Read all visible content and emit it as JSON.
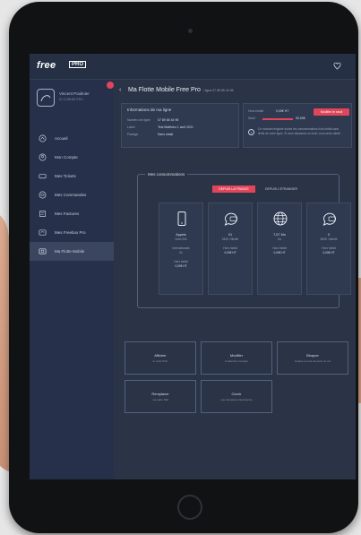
{
  "app": {
    "logo_text": "free",
    "logo_badge": "PRO"
  },
  "user": {
    "name": "Vincent Poulinier",
    "subtitle": "ID CONNECTED"
  },
  "sidebar": {
    "items": [
      {
        "label": "Accueil",
        "icon": "home-icon"
      },
      {
        "label": "Mon Compte",
        "icon": "user-icon"
      },
      {
        "label": "Mes Tickets",
        "icon": "ticket-icon"
      },
      {
        "label": "Mes Commandes",
        "icon": "cart-icon"
      },
      {
        "label": "Mes Factures",
        "icon": "invoice-icon"
      },
      {
        "label": "Mes Freebox Pro",
        "icon": "freebox-icon"
      },
      {
        "label": "Ma Flotte Mobile",
        "icon": "mobile-icon"
      }
    ],
    "active_index": 6
  },
  "header": {
    "title": "Ma Flotte Mobile Free Pro",
    "subtitle": "/ ligne 07 89 65 44 95"
  },
  "line_info": {
    "title": "Informations de ma ligne",
    "rows": [
      {
        "label": "Numéro de ligne",
        "value": "07 89 65 44 95"
      },
      {
        "label": "Label",
        "value": "Test Matthieu 1 avril 2021"
      },
      {
        "label": "Partage",
        "value": "Sans shaki"
      }
    ]
  },
  "conso_summary": {
    "row1_label": "Hors forfait",
    "row1_value": "0,00€ HT",
    "row2_label": "Seuil",
    "row2_value": "50,00€",
    "button": "Modifier le seuil",
    "info": "Ce montant englobe toutes les consommations hors forfait sans limite de votre ligne. Si vous dépassez ce seuil, vous serez alerté."
  },
  "consumptions": {
    "title": "Mes consommations",
    "tabs": [
      "DEPUIS LA FRANCE",
      "DEPUIS L'ETRANGER"
    ],
    "active_tab": 0,
    "cards": [
      {
        "icon": "phone-icon",
        "main": "Appels",
        "sub1": "0min 00s",
        "sub2": "Internationale",
        "sub3": "0s",
        "sub4": "Hors forfait",
        "sub5": "0,00€ HT"
      },
      {
        "icon": "sms-icon",
        "main": "01",
        "sub1": "SMS / illimité",
        "sub2": "Hors forfait",
        "sub3": "0,00€ HT",
        "sub4": "",
        "sub5": ""
      },
      {
        "icon": "globe-icon",
        "main": "7,67 Mo",
        "sub1": "Go",
        "sub2": "Hors forfait",
        "sub3": "0,00€ HT",
        "sub4": "",
        "sub5": ""
      },
      {
        "icon": "mms-icon",
        "main": "0",
        "sub1": "MMS / illimité",
        "sub2": "Hors forfait",
        "sub3": "0,00€ HT",
        "sub4": "",
        "sub5": ""
      }
    ]
  },
  "actions": [
    {
      "title": "Afficher",
      "sub": "le code PUK"
    },
    {
      "title": "Modifier",
      "sub": "le label de ma ligne"
    },
    {
      "title": "Bloquer",
      "sub": "la ligne en cas de perte ou vol"
    },
    {
      "title": "Remplacer",
      "sub": "ma carte SIM"
    },
    {
      "title": "Ouvrir",
      "sub": "une demande d'assistance"
    }
  ],
  "colors": {
    "accent": "#e0455a",
    "background": "#2b3446",
    "sidebar": "#26304a"
  }
}
